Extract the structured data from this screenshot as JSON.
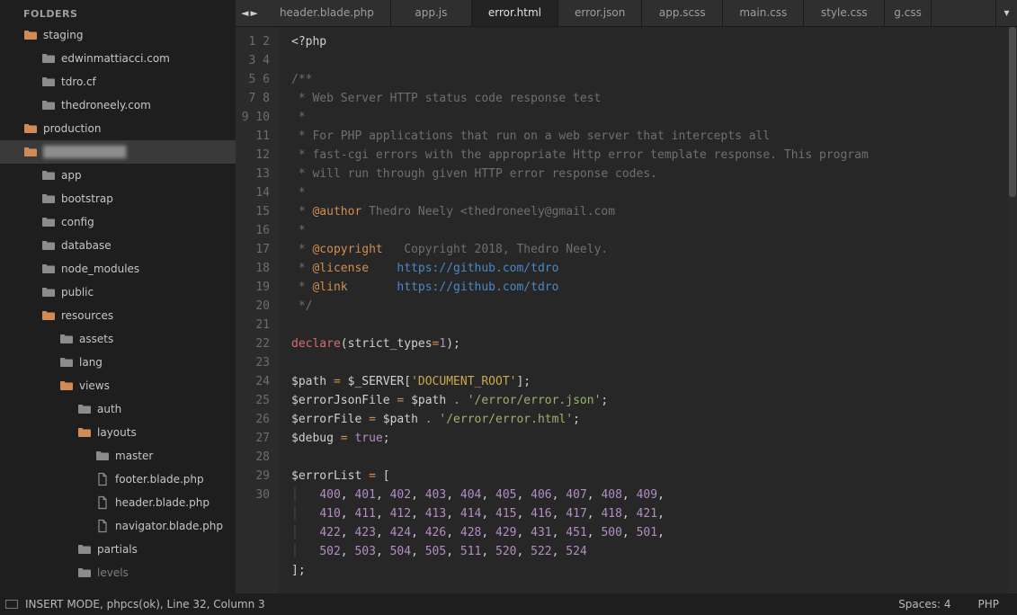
{
  "sidebar": {
    "heading": "FOLDERS",
    "tree": [
      {
        "type": "folder-open",
        "depth": 0,
        "label": "staging"
      },
      {
        "type": "folder",
        "depth": 1,
        "label": "edwinmattiacci.com"
      },
      {
        "type": "folder",
        "depth": 1,
        "label": "tdro.cf"
      },
      {
        "type": "folder",
        "depth": 1,
        "label": "thedroneely.com"
      },
      {
        "type": "folder-open",
        "depth": 0,
        "label": "production"
      },
      {
        "type": "folder-open",
        "depth": 0,
        "label": "██████████",
        "selected": true,
        "blur": true
      },
      {
        "type": "folder",
        "depth": 1,
        "label": "app"
      },
      {
        "type": "folder",
        "depth": 1,
        "label": "bootstrap"
      },
      {
        "type": "folder",
        "depth": 1,
        "label": "config"
      },
      {
        "type": "folder",
        "depth": 1,
        "label": "database"
      },
      {
        "type": "folder",
        "depth": 1,
        "label": "node_modules"
      },
      {
        "type": "folder",
        "depth": 1,
        "label": "public"
      },
      {
        "type": "folder-open",
        "depth": 1,
        "label": "resources"
      },
      {
        "type": "folder",
        "depth": 2,
        "label": "assets"
      },
      {
        "type": "folder",
        "depth": 2,
        "label": "lang"
      },
      {
        "type": "folder-open",
        "depth": 2,
        "label": "views"
      },
      {
        "type": "folder",
        "depth": 3,
        "label": "auth"
      },
      {
        "type": "folder-open",
        "depth": 3,
        "label": "layouts"
      },
      {
        "type": "folder",
        "depth": 4,
        "label": "master"
      },
      {
        "type": "file",
        "depth": 4,
        "label": "footer.blade.php"
      },
      {
        "type": "file",
        "depth": 4,
        "label": "header.blade.php"
      },
      {
        "type": "file",
        "depth": 4,
        "label": "navigator.blade.php"
      },
      {
        "type": "folder",
        "depth": 3,
        "label": "partials"
      },
      {
        "type": "folder",
        "depth": 3,
        "label": "levels",
        "dim": true
      }
    ]
  },
  "tabs": {
    "arrows": {
      "left": "◄",
      "right": "►"
    },
    "items": [
      {
        "label": "header.blade.php",
        "active": false
      },
      {
        "label": "app.js",
        "active": false
      },
      {
        "label": "error.html",
        "active": true
      },
      {
        "label": "error.json",
        "active": false
      },
      {
        "label": "app.scss",
        "active": false
      },
      {
        "label": "main.css",
        "active": false
      },
      {
        "label": "style.css",
        "active": false
      },
      {
        "label": "g.css",
        "active": false
      }
    ],
    "overflow": "▾"
  },
  "code": {
    "line_count": 30,
    "lines_html": [
      "<span class='p'>&lt;?php</span>",
      "",
      "<span class='c'>/**</span>",
      "<span class='c'> * Web Server HTTP status code response test</span>",
      "<span class='c'> *</span>",
      "<span class='c'> * For PHP applications that run on a web server that intercepts all</span>",
      "<span class='c'> * fast-cgi errors with the appropriate Http error template response. This program</span>",
      "<span class='c'> * will run through given HTTP error response codes.</span>",
      "<span class='c'> *</span>",
      "<span class='c'> * </span><span class='ct'>@author</span><span class='c'> Thedro Neely &lt;thedroneely@gmail.com</span>",
      "<span class='c'> *</span>",
      "<span class='c'> * </span><span class='ct'>@copyright</span><span class='c'>   Copyright 2018, Thedro Neely.</span>",
      "<span class='c'> * </span><span class='ct'>@license</span><span class='c'>    </span><span class='cl'>https://github.com/tdro</span>",
      "<span class='c'> * </span><span class='ct'>@link</span><span class='c'>       </span><span class='cl'>https://github.com/tdro</span>",
      "<span class='c'> */</span>",
      "",
      "<span class='k'>declare</span><span class='p'>(</span><span class='id'>strict_types</span><span class='op'>=</span><span class='n'>1</span><span class='p'>);</span>",
      "",
      "<span class='v'>$path</span> <span class='op'>=</span> <span class='v'>$_SERVER</span><span class='p'>[</span><span class='sy'>'DOCUMENT_ROOT'</span><span class='p'>];</span>",
      "<span class='v'>$errorJsonFile</span> <span class='op'>=</span> <span class='v'>$path</span> <span class='op'>.</span> <span class='s'>'/error/error.json'</span><span class='p'>;</span>",
      "<span class='v'>$errorFile</span> <span class='op'>=</span> <span class='v'>$path</span> <span class='op'>.</span> <span class='s'>'/error/error.html'</span><span class='p'>;</span>",
      "<span class='v'>$debug</span> <span class='op'>=</span> <span class='b'>true</span><span class='p'>;</span>",
      "",
      "<span class='v'>$errorList</span> <span class='op'>=</span> <span class='p'>[</span>",
      "<span class='guide'>│   </span><span class='n'>400</span><span class='p'>,</span> <span class='n'>401</span><span class='p'>,</span> <span class='n'>402</span><span class='p'>,</span> <span class='n'>403</span><span class='p'>,</span> <span class='n'>404</span><span class='p'>,</span> <span class='n'>405</span><span class='p'>,</span> <span class='n'>406</span><span class='p'>,</span> <span class='n'>407</span><span class='p'>,</span> <span class='n'>408</span><span class='p'>,</span> <span class='n'>409</span><span class='p'>,</span>",
      "<span class='guide'>│   </span><span class='n'>410</span><span class='p'>,</span> <span class='n'>411</span><span class='p'>,</span> <span class='n'>412</span><span class='p'>,</span> <span class='n'>413</span><span class='p'>,</span> <span class='n'>414</span><span class='p'>,</span> <span class='n'>415</span><span class='p'>,</span> <span class='n'>416</span><span class='p'>,</span> <span class='n'>417</span><span class='p'>,</span> <span class='n'>418</span><span class='p'>,</span> <span class='n'>421</span><span class='p'>,</span>",
      "<span class='guide'>│   </span><span class='n'>422</span><span class='p'>,</span> <span class='n'>423</span><span class='p'>,</span> <span class='n'>424</span><span class='p'>,</span> <span class='n'>426</span><span class='p'>,</span> <span class='n'>428</span><span class='p'>,</span> <span class='n'>429</span><span class='p'>,</span> <span class='n'>431</span><span class='p'>,</span> <span class='n'>451</span><span class='p'>,</span> <span class='n'>500</span><span class='p'>,</span> <span class='n'>501</span><span class='p'>,</span>",
      "<span class='guide'>│   </span><span class='n'>502</span><span class='p'>,</span> <span class='n'>503</span><span class='p'>,</span> <span class='n'>504</span><span class='p'>,</span> <span class='n'>505</span><span class='p'>,</span> <span class='n'>511</span><span class='p'>,</span> <span class='n'>520</span><span class='p'>,</span> <span class='n'>522</span><span class='p'>,</span> <span class='n'>524</span>",
      "<span class='p'>];</span>",
      ""
    ]
  },
  "status": {
    "left": "INSERT MODE, phpcs(ok), Line 32, Column 3",
    "spaces": "Spaces: 4",
    "lang": "PHP"
  }
}
